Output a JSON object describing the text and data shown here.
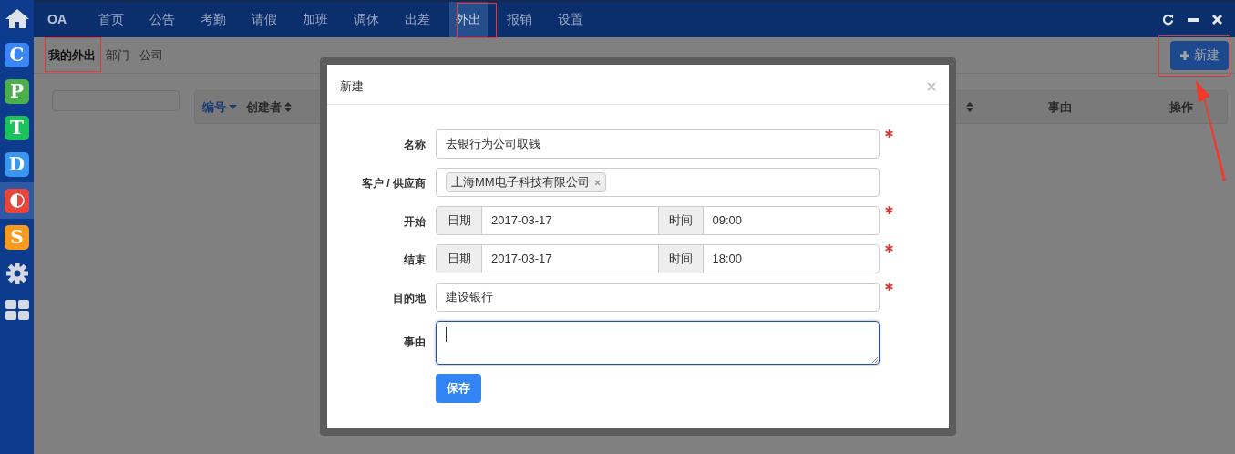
{
  "nav": {
    "brand": "OA",
    "items": [
      {
        "label": "首页",
        "selected": false
      },
      {
        "label": "公告",
        "selected": false
      },
      {
        "label": "考勤",
        "selected": false
      },
      {
        "label": "请假",
        "selected": false
      },
      {
        "label": "加班",
        "selected": false
      },
      {
        "label": "调休",
        "selected": false
      },
      {
        "label": "出差",
        "selected": false
      },
      {
        "label": "外出",
        "selected": true
      },
      {
        "label": "报销",
        "selected": false
      },
      {
        "label": "设置",
        "selected": false
      }
    ]
  },
  "sidebar": {
    "items": [
      {
        "kind": "home",
        "selected": false
      },
      {
        "kind": "app",
        "glyph": "C",
        "color": "#3d86f7",
        "selected": false
      },
      {
        "kind": "app",
        "glyph": "P",
        "color": "#4cae4c",
        "selected": false
      },
      {
        "kind": "app",
        "glyph": "T",
        "color": "#19c25a",
        "selected": false
      },
      {
        "kind": "app",
        "glyph": "D",
        "color": "#3a97f0",
        "selected": false
      },
      {
        "kind": "half",
        "color": "#e8453c",
        "selected": true
      },
      {
        "kind": "app",
        "glyph": "S",
        "color": "#f89a1e",
        "selected": false
      },
      {
        "kind": "gear",
        "selected": false
      },
      {
        "kind": "grid",
        "selected": false
      }
    ]
  },
  "subnav": {
    "tabs": [
      {
        "label": "我的外出",
        "selected": true
      },
      {
        "label": "部门",
        "selected": false
      },
      {
        "label": "公司",
        "selected": false
      }
    ]
  },
  "new_button": "新建",
  "table": {
    "columns": [
      {
        "kind": "sorted",
        "label": "编号"
      },
      {
        "kind": "sortable",
        "label": "创建者"
      },
      {
        "kind": "sortable"
      },
      {
        "kind": "plain",
        "label": "事由"
      },
      {
        "kind": "plain",
        "label": "操作"
      }
    ]
  },
  "modal": {
    "title": "新建",
    "fields": [
      {
        "kind": "text",
        "label": "名称",
        "value": "去银行为公司取钱",
        "required": true
      },
      {
        "kind": "tags",
        "label": "客户 / 供应商",
        "tags": [
          "上海MM电子科技有限公司"
        ],
        "required": false
      },
      {
        "kind": "datetime",
        "label": "开始",
        "date_label": "日期",
        "date": "2017-03-17",
        "time_label": "时间",
        "time": "09:00",
        "required": true
      },
      {
        "kind": "datetime",
        "label": "结束",
        "date_label": "日期",
        "date": "2017-03-17",
        "time_label": "时间",
        "time": "18:00",
        "required": true
      },
      {
        "kind": "text",
        "label": "目的地",
        "value": "建设银行",
        "required": true
      },
      {
        "kind": "textarea",
        "label": "事由",
        "focused": true,
        "required": false
      }
    ],
    "save": "保存"
  }
}
